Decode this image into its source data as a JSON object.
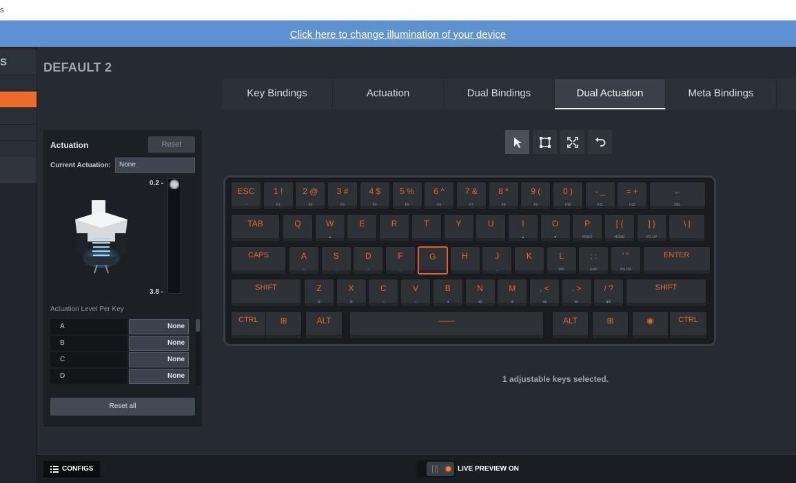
{
  "window": {
    "title": "s"
  },
  "banner": {
    "link_text": "Click here to change illumination of your device"
  },
  "sidebar": {
    "head": "S"
  },
  "config": {
    "name": "DEFAULT 2"
  },
  "tabs": [
    {
      "label": "Key Bindings"
    },
    {
      "label": "Actuation"
    },
    {
      "label": "Dual Bindings"
    },
    {
      "label": "Dual Actuation",
      "active": true
    },
    {
      "label": "Meta Bindings"
    }
  ],
  "actuation_panel": {
    "title": "Actuation",
    "reset_label": "Reset",
    "current_label": "Current Actuation:",
    "current_value": "None",
    "slider_top_label": "0.2 -",
    "slider_bottom_label": "3.8 -",
    "per_key_label": "Actuation Level Per Key",
    "keys": [
      {
        "name": "A",
        "value": "None"
      },
      {
        "name": "B",
        "value": "None"
      },
      {
        "name": "C",
        "value": "None"
      },
      {
        "name": "D",
        "value": "None"
      }
    ],
    "reset_all_label": "Reset all"
  },
  "tools": [
    {
      "name": "select-pointer-icon",
      "active": true
    },
    {
      "name": "marquee-select-icon"
    },
    {
      "name": "select-all-icon"
    },
    {
      "name": "undo-icon"
    }
  ],
  "keyboard": {
    "accent_color": "#e4692c",
    "rows": [
      [
        {
          "p": "ESC",
          "s": "`~"
        },
        {
          "p": "1 !",
          "s": "F1"
        },
        {
          "p": "2 @",
          "s": "F2"
        },
        {
          "p": "3 #",
          "s": "F3"
        },
        {
          "p": "4 $",
          "s": "F4"
        },
        {
          "p": "5 %",
          "s": "F5"
        },
        {
          "p": "6 ^",
          "s": "F6"
        },
        {
          "p": "7 &",
          "s": "F7"
        },
        {
          "p": "8 *",
          "s": "F8"
        },
        {
          "p": "9 (",
          "s": "F9"
        },
        {
          "p": "0 )",
          "s": "F10"
        },
        {
          "p": "- _",
          "s": "F11"
        },
        {
          "p": "= +",
          "s": "F12"
        },
        {
          "p": "←",
          "s": "DEL"
        }
      ],
      [
        {
          "p": "TAB",
          "s": ""
        },
        {
          "p": "Q",
          "s": ""
        },
        {
          "p": "W",
          "s": "▲"
        },
        {
          "p": "E",
          "s": ""
        },
        {
          "p": "R",
          "s": ""
        },
        {
          "p": "T",
          "s": ""
        },
        {
          "p": "Y",
          "s": ""
        },
        {
          "p": "U",
          "s": ""
        },
        {
          "p": "I",
          "s": "▲"
        },
        {
          "p": "O",
          "s": "▼"
        },
        {
          "p": "P",
          "s": "PRINT"
        },
        {
          "p": "[ {",
          "s": "HOME"
        },
        {
          "p": "] }",
          "s": "PG UP"
        },
        {
          "p": "\\ |",
          "s": ""
        }
      ],
      [
        {
          "p": "CAPS",
          "s": ""
        },
        {
          "p": "A",
          "s": "‹"
        },
        {
          "p": "S",
          "s": "⌄"
        },
        {
          "p": "D",
          "s": "›"
        },
        {
          "p": "F",
          "s": "_"
        },
        {
          "p": "G",
          "s": "",
          "selected": true
        },
        {
          "p": "H",
          "s": ""
        },
        {
          "p": "J",
          "s": "_"
        },
        {
          "p": "K",
          "s": ""
        },
        {
          "p": "L",
          "s": "INS"
        },
        {
          "p": "; :",
          "s": "END"
        },
        {
          "p": "' \"",
          "s": "PG DN"
        },
        {
          "p": "ENTER",
          "s": ""
        }
      ],
      [
        {
          "p": "SHIFT",
          "s": ""
        },
        {
          "p": "Z",
          "s": "⚙"
        },
        {
          "p": "X",
          "s": "⚙"
        },
        {
          "p": "C",
          "s": "☼"
        },
        {
          "p": "V",
          "s": "☼"
        },
        {
          "p": "B",
          "s": "◂"
        },
        {
          "p": "N",
          "s": "◂))"
        },
        {
          "p": "M",
          "s": "◂)"
        },
        {
          "p": ", <",
          "s": "◂◂"
        },
        {
          "p": ". >",
          "s": "▸▸"
        },
        {
          "p": "/ ?",
          "s": "▶ll"
        },
        {
          "p": "SHIFT",
          "s": ""
        }
      ],
      [
        {
          "p": "CTRL",
          "s": ""
        },
        {
          "p": "⊞",
          "s": ""
        },
        {
          "p": "ALT",
          "s": ""
        },
        {
          "p": "——",
          "s": ""
        },
        {
          "p": "ALT",
          "s": ""
        },
        {
          "p": "⊞",
          "s": ""
        },
        {
          "p": "◉",
          "s": ""
        },
        {
          "p": "CTRL",
          "s": ""
        }
      ]
    ]
  },
  "selection_info": "1 adjustable keys selected.",
  "bottom": {
    "configs_label": "CONFIGS",
    "live_preview_label": "LIVE PREVIEW ON"
  }
}
